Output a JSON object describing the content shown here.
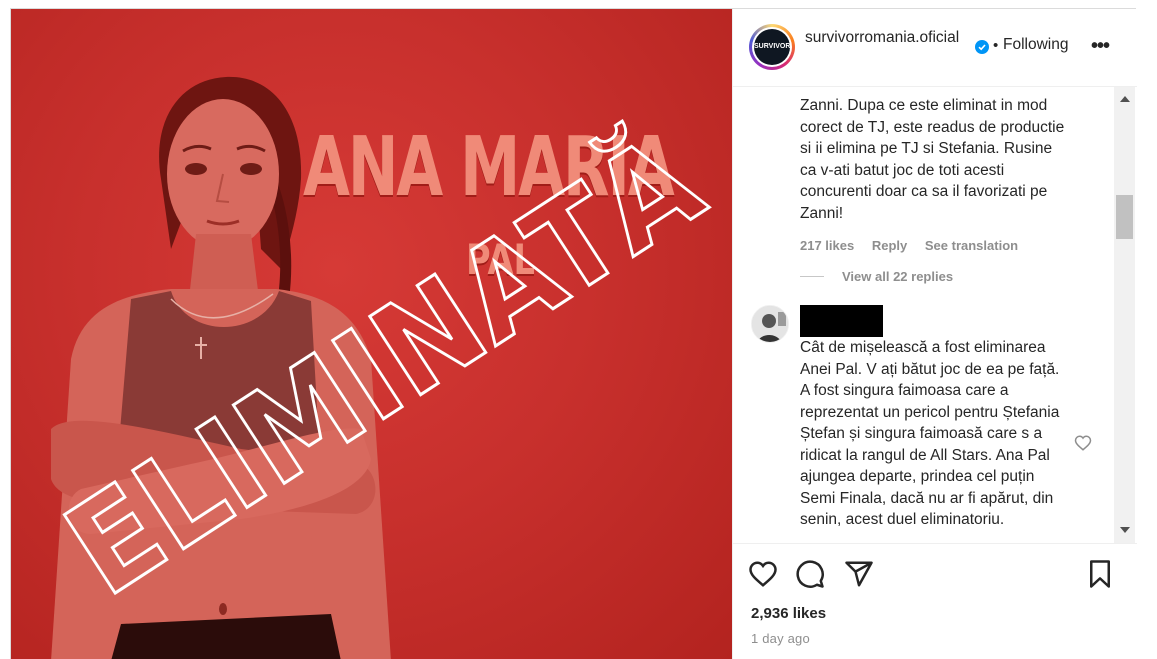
{
  "post_image": {
    "headline": "ANA MARIA",
    "subline": "PAL",
    "stamp_text": "ELIMINATĂ"
  },
  "header": {
    "avatar_label": "SURVIVOR",
    "username": "survivorromania.oficial",
    "separator": "•",
    "follow_status": "Following",
    "more": "•••"
  },
  "comments": [
    {
      "text": "Zanni. Dupa ce este eliminat in mod corect de TJ, este readus de productie si ii elimina pe TJ si Stefania. Rusine ca v-ati batut joc de toti acesti concurenti doar ca sa il favorizati pe Zanni!",
      "likes": "217 likes",
      "reply": "Reply",
      "translate": "See translation",
      "view_replies": "View all 22 replies"
    },
    {
      "text": "Cât de mișelească a fost eliminarea Anei Pal. V ați bătut joc de ea pe față. A fost singura faimoasa care a reprezentat un pericol pentru Ștefania Ștefan și singura faimoasă care s a ridicat la rangul de All Stars. Ana Pal ajungea departe, prindea cel puțin Semi Finala, dacă nu ar fi apărut, din senin, acest duel eliminatoriu."
    }
  ],
  "footer": {
    "likes": "2,936 likes",
    "time": "1 day ago"
  },
  "colors": {
    "brand_red": "#c8302d",
    "verified_blue": "#0095f6",
    "text_primary": "#262626",
    "text_secondary": "#8e8e8e"
  },
  "icons": [
    "heart-icon",
    "comment-icon",
    "share-icon",
    "bookmark-icon",
    "verified-badge-icon",
    "more-options-icon",
    "heart-small-icon"
  ]
}
